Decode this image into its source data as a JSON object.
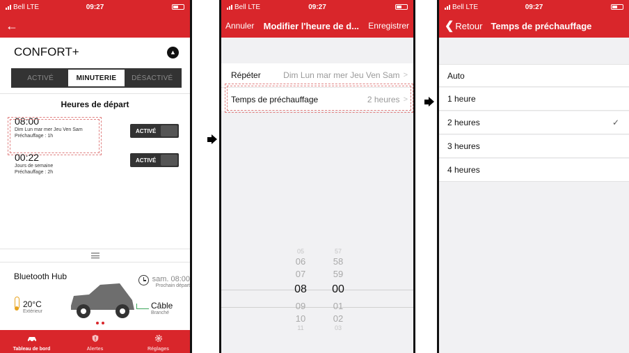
{
  "status": {
    "carrier": "Bell LTE",
    "time": "09:27"
  },
  "screen1": {
    "profile_title": "CONFORT+",
    "segments": [
      "ACTIVÉ",
      "MINUTERIE",
      "DÉSACTIVÉ"
    ],
    "selected_segment": "MINUTERIE",
    "departures_title": "Heures de départ",
    "departures": [
      {
        "time": "08:00",
        "days": "Dim Lun mar mer Jeu Ven Sam",
        "preheat": "Préchauffage : 1h",
        "toggle": "ACTIVÉ"
      },
      {
        "time": "00:22",
        "days": "Jours de semaine",
        "preheat": "Préchauffage : 2h",
        "toggle": "ACTIVÉ"
      }
    ],
    "hub": {
      "title": "Bluetooth Hub",
      "next_time": "sam. 08:00",
      "next_label": "Prochain départ",
      "temp": "20°C",
      "temp_label": "Extérieur",
      "cable": "Câble",
      "cable_label": "Branché"
    },
    "tabs": [
      "Tableau de bord",
      "Alertes",
      "Réglages"
    ]
  },
  "screen2": {
    "cancel": "Annuler",
    "title": "Modifier l'heure de d...",
    "save": "Enregistrer",
    "repeat_label": "Répéter",
    "repeat_value": "Dim Lun mar mer Jeu Ven Sam",
    "preheat_label": "Temps de préchauffage",
    "preheat_value": "2 heures",
    "picker_hours": [
      "05",
      "06",
      "07",
      "08",
      "09",
      "10",
      "11"
    ],
    "picker_minutes": [
      "57",
      "58",
      "59",
      "00",
      "01",
      "02",
      "03"
    ],
    "selected_hour": "08",
    "selected_minute": "00"
  },
  "screen3": {
    "back": "Retour",
    "title": "Temps de préchauffage",
    "options": [
      "Auto",
      "1 heure",
      "2 heures",
      "3 heures",
      "4 heures"
    ],
    "selected_index": 2
  },
  "colors": {
    "brand_red": "#d9262b",
    "dash_red": "#e08080",
    "cable_green": "#3ca65b",
    "temp_orange": "#e7a21c"
  }
}
